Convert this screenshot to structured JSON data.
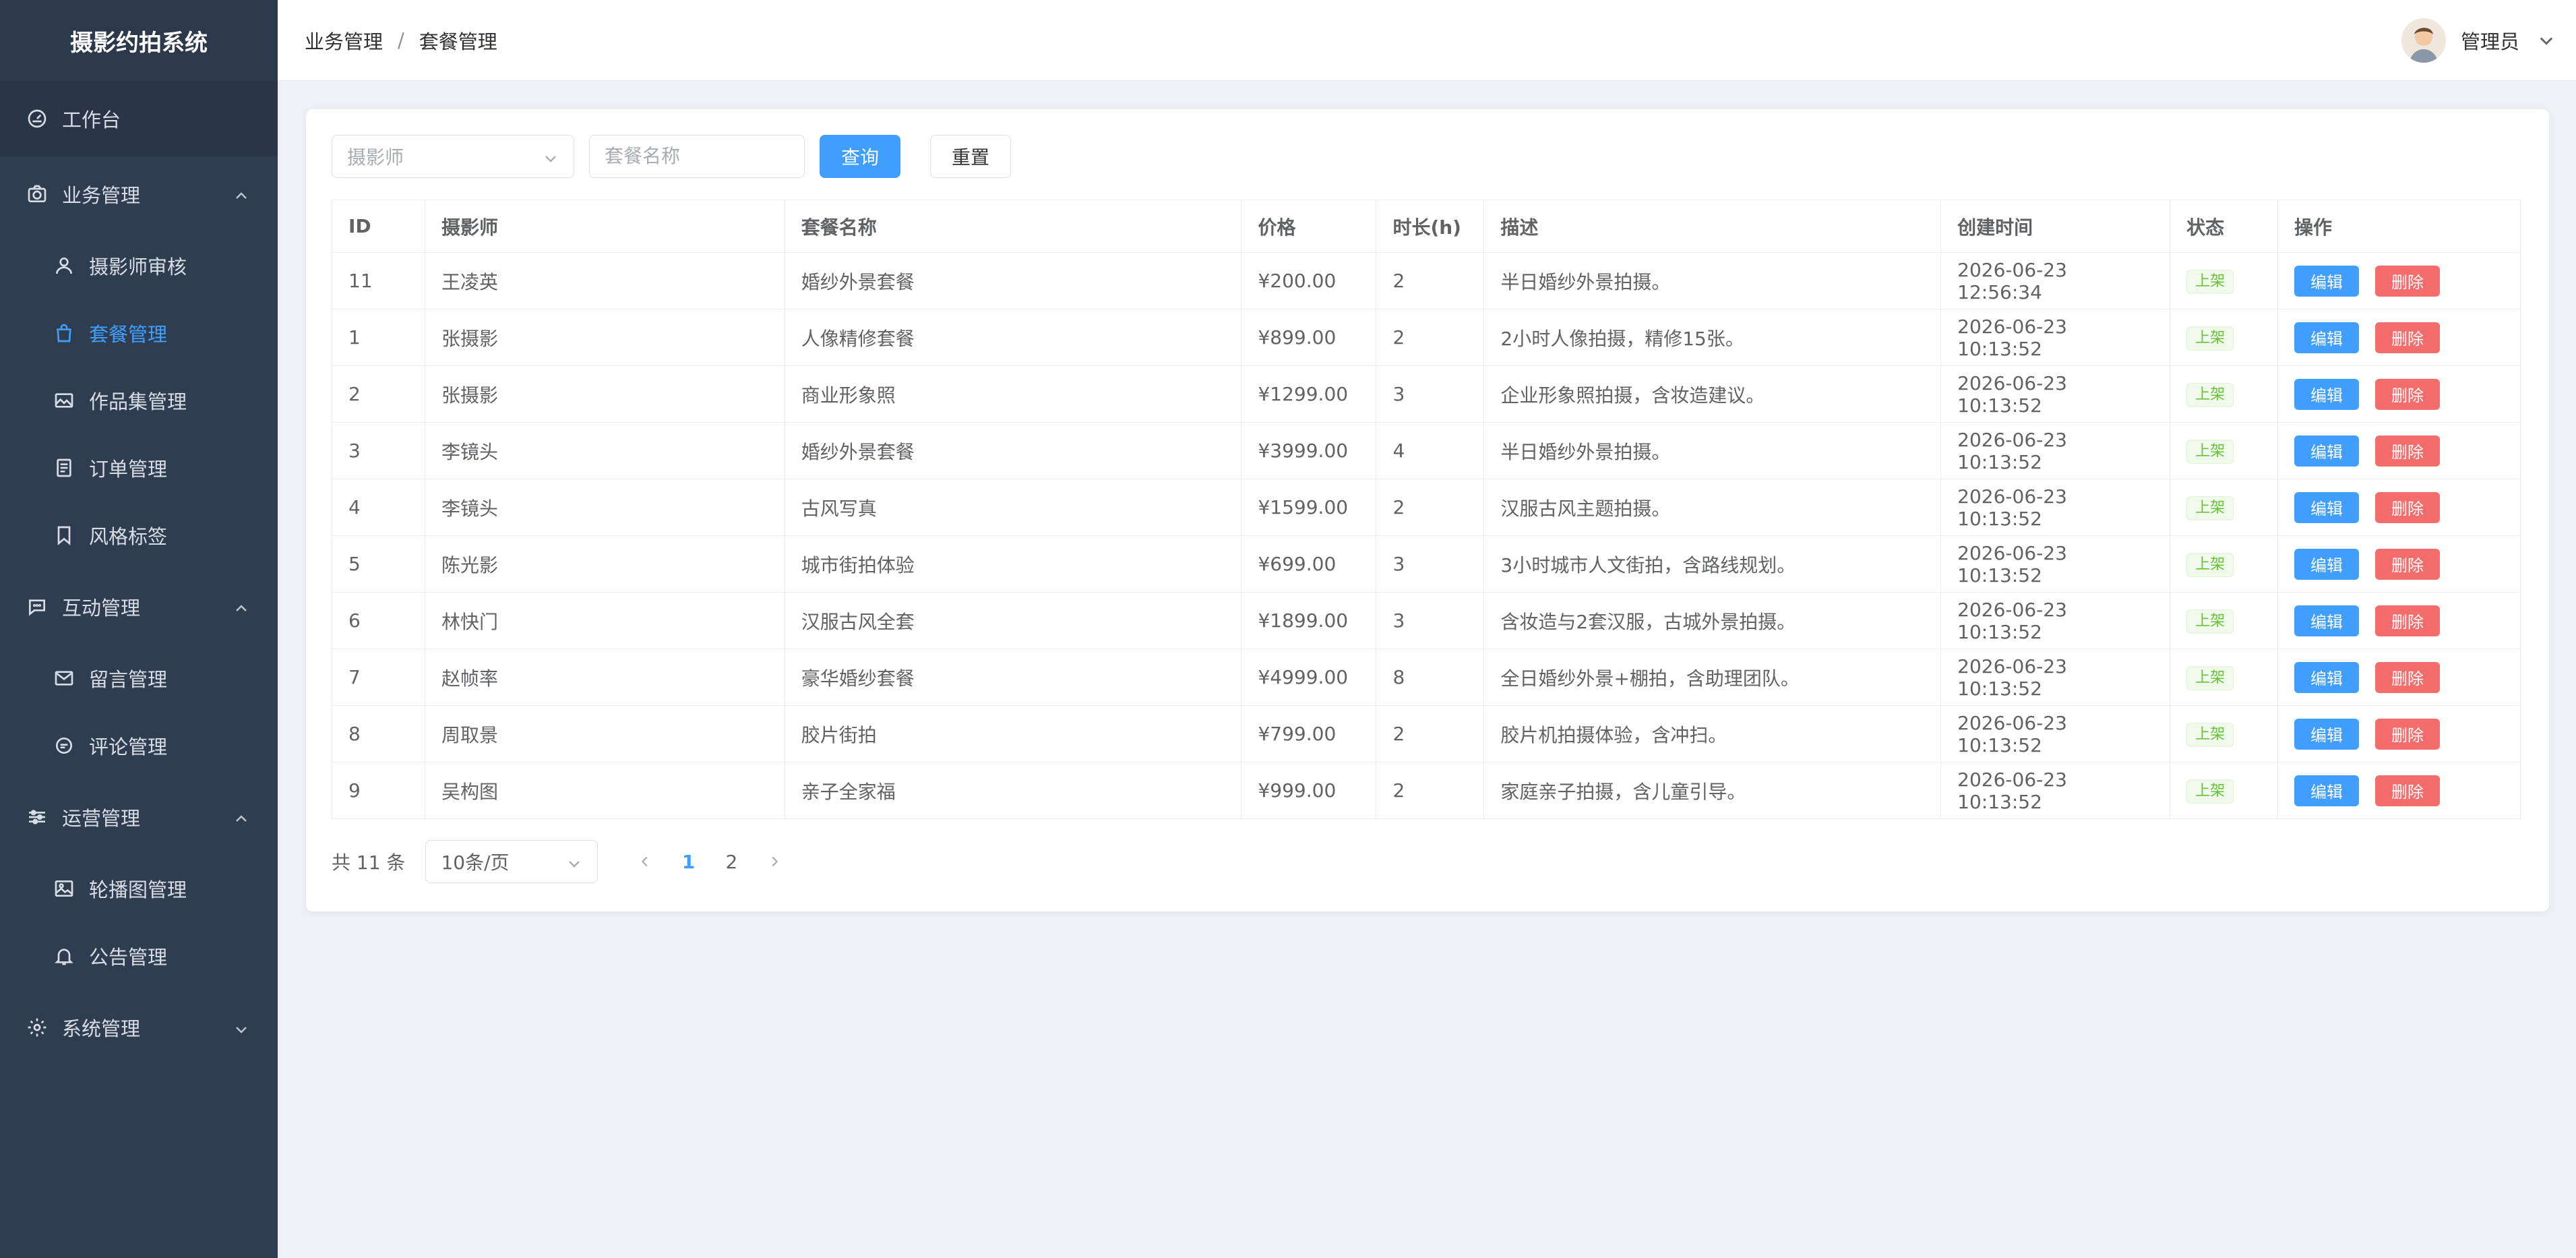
{
  "app": {
    "title": "摄影约拍系统"
  },
  "sidebar": {
    "workbench": "工作台",
    "groups": [
      {
        "label": "业务管理",
        "items": [
          "摄影师审核",
          "套餐管理",
          "作品集管理",
          "订单管理",
          "风格标签"
        ]
      },
      {
        "label": "互动管理",
        "items": [
          "留言管理",
          "评论管理"
        ]
      },
      {
        "label": "运营管理",
        "items": [
          "轮播图管理",
          "公告管理"
        ]
      },
      {
        "label": "系统管理",
        "items": []
      }
    ]
  },
  "header": {
    "breadcrumb": [
      "业务管理",
      "套餐管理"
    ],
    "breadcrumb_sep": "/",
    "user": "管理员"
  },
  "toolbar": {
    "photographer_placeholder": "摄影师",
    "package_placeholder": "套餐名称",
    "query_label": "查询",
    "reset_label": "重置"
  },
  "table": {
    "columns": [
      "ID",
      "摄影师",
      "套餐名称",
      "价格",
      "时长(h)",
      "描述",
      "创建时间",
      "状态",
      "操作"
    ],
    "rows": [
      {
        "id": "11",
        "photographer": "王凌英",
        "name": "婚纱外景套餐",
        "price": "¥200.00",
        "duration": "2",
        "desc": "半日婚纱外景拍摄。",
        "created": "2026-06-23 12:56:34",
        "status": "上架"
      },
      {
        "id": "1",
        "photographer": "张摄影",
        "name": "人像精修套餐",
        "price": "¥899.00",
        "duration": "2",
        "desc": "2小时人像拍摄，精修15张。",
        "created": "2026-06-23 10:13:52",
        "status": "上架"
      },
      {
        "id": "2",
        "photographer": "张摄影",
        "name": "商业形象照",
        "price": "¥1299.00",
        "duration": "3",
        "desc": "企业形象照拍摄，含妆造建议。",
        "created": "2026-06-23 10:13:52",
        "status": "上架"
      },
      {
        "id": "3",
        "photographer": "李镜头",
        "name": "婚纱外景套餐",
        "price": "¥3999.00",
        "duration": "4",
        "desc": "半日婚纱外景拍摄。",
        "created": "2026-06-23 10:13:52",
        "status": "上架"
      },
      {
        "id": "4",
        "photographer": "李镜头",
        "name": "古风写真",
        "price": "¥1599.00",
        "duration": "2",
        "desc": "汉服古风主题拍摄。",
        "created": "2026-06-23 10:13:52",
        "status": "上架"
      },
      {
        "id": "5",
        "photographer": "陈光影",
        "name": "城市街拍体验",
        "price": "¥699.00",
        "duration": "3",
        "desc": "3小时城市人文街拍，含路线规划。",
        "created": "2026-06-23 10:13:52",
        "status": "上架"
      },
      {
        "id": "6",
        "photographer": "林快门",
        "name": "汉服古风全套",
        "price": "¥1899.00",
        "duration": "3",
        "desc": "含妆造与2套汉服，古城外景拍摄。",
        "created": "2026-06-23 10:13:52",
        "status": "上架"
      },
      {
        "id": "7",
        "photographer": "赵帧率",
        "name": "豪华婚纱套餐",
        "price": "¥4999.00",
        "duration": "8",
        "desc": "全日婚纱外景+棚拍，含助理团队。",
        "created": "2026-06-23 10:13:52",
        "status": "上架"
      },
      {
        "id": "8",
        "photographer": "周取景",
        "name": "胶片街拍",
        "price": "¥799.00",
        "duration": "2",
        "desc": "胶片机拍摄体验，含冲扫。",
        "created": "2026-06-23 10:13:52",
        "status": "上架"
      },
      {
        "id": "9",
        "photographer": "吴构图",
        "name": "亲子全家福",
        "price": "¥999.00",
        "duration": "2",
        "desc": "家庭亲子拍摄，含儿童引导。",
        "created": "2026-06-23 10:13:52",
        "status": "上架"
      }
    ],
    "edit_label": "编辑",
    "delete_label": "删除"
  },
  "pagination": {
    "total": "共 11 条",
    "page_size": "10条/页",
    "pages": [
      "1",
      "2"
    ],
    "current": "1"
  },
  "colors": {
    "primary": "#409eff",
    "danger": "#f56c6c",
    "success": "#67c23a",
    "sidebar": "#2f3d50"
  }
}
